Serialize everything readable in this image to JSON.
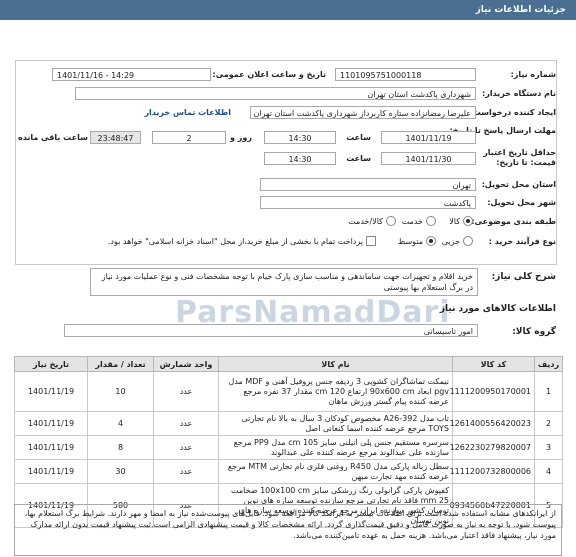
{
  "header": {
    "title": "جزئیات اطلاعات نیاز"
  },
  "form": {
    "need_number_label": "شماره نیاز:",
    "need_number": "1101095751000118",
    "announce_label": "تاریخ و ساعت اعلان عمومی:",
    "announce_value": "1401/11/16 - 14:29",
    "buyer_label": "نام دستگاه خریدار:",
    "buyer_value": "شهرداری پاکدشت استان تهران",
    "creator_label": "ایجاد کننده درخواست:",
    "creator_value": "علیرضا رمضانزاده ستاره کاربرداز شهرداری پاکدشت استان تهران",
    "contact_link": "اطلاعات تماس خریدار",
    "deadline_label": "مهلت ارسال پاسخ تا تاریخ:",
    "deadline_date": "1401/11/19",
    "time_label": "ساعت",
    "deadline_time": "14:30",
    "day_value": "2",
    "day_label": "روز و",
    "countdown": "23:48:47",
    "remaining_label": "ساعت باقی مانده",
    "validity_label": "حداقل تاریخ اعتبار",
    "validity_label2": "قیمت: تا تاریخ:",
    "validity_date": "1401/11/30",
    "validity_time": "14:30",
    "province_label": "استان محل تحویل:",
    "province_value": "تهران",
    "city_label": "شهر محل تحویل:",
    "city_value": "پاکدشت",
    "category_label": "طبقه بندی موضوعی:",
    "category_options": [
      "کالا",
      "خدمت",
      "کالا/خدمت"
    ],
    "purchase_type_label": "نوع فرآیند خرید :",
    "purchase_options": [
      "جزیی",
      "متوسط"
    ],
    "payment_note": "پرداخت تمام یا بخشی از مبلغ خرید،از محل \"اسناد خزانه اسلامی\" خواهد بود."
  },
  "need": {
    "summary_label": "شرح کلی نیاز:",
    "summary": "خرید اقلام و تجهیزات جهت ساماندهی و مناسب سازی پارک خیام با توجه مشخصات فنی و نوع عملیات مورد نیاز در برگ استعلام بها پیوستی",
    "goods_title": "اطلاعات کالاهای مورد نیاز",
    "group_label": "گروه کالا:",
    "group_value": "امور تاسیساتی"
  },
  "table": {
    "headers": [
      "ردیف",
      "کد کالا",
      "نام کالا",
      "واحد شمارش",
      "تعداد / مقدار",
      "تاریخ نیاز"
    ],
    "rows": [
      {
        "row": "1",
        "code": "1111200950170001",
        "name": "نیمکت تماشاگران کشویی 3 ردیفه جنس پروفیل آهنی و MDF مدل pgv ابعاد 90x600 cm ارتفاع 120 cm مقدار 37 نفره مرجع عرضه کننده پیام گستر ورزش ماهان",
        "unit": "عدد",
        "qty": "10",
        "date": "1401/11/19"
      },
      {
        "row": "2",
        "code": "1261400556420023",
        "name": "تاب مدل A26-392 مخصوص کودکان 3 سال به بالا نام تجارتی TOYS مرجع عرضه کننده اسما کنعانی اصل",
        "unit": "عدد",
        "qty": "4",
        "date": "1401/11/19"
      },
      {
        "row": "3",
        "code": "1262230279820007",
        "name": "سرسره مستقیم جنس پلی اتیلنی سایز 105 cm مدل PP9 مرجع سازنده علی عبدالوند مرجع عرضه کننده علی عبدالوند",
        "unit": "عدد",
        "qty": "8",
        "date": "1401/11/19"
      },
      {
        "row": "4",
        "code": "1111200732800006",
        "name": "سطل زباله پارکی مدل R450 روغنی فلزی نام تجارتی MTM مرجع عرضه کننده مهد تجارت میهن",
        "unit": "عدد",
        "qty": "30",
        "date": "1401/11/19"
      },
      {
        "row": "5",
        "code": "0934560b47220001",
        "name": "کفپوش پارکی گرانولی رنگ زرشکی سایز 100x100 cm ضخامت 25 mm فاقد نام تجارتی مرجع سازنده توسعه سازه های نوین توسان کشور سازنده ایران مرجع عرضه کننده توسعه سازه های نوین توسان",
        "unit": "عدد",
        "qty": "580",
        "date": "1401/11/19"
      }
    ]
  },
  "notes": {
    "text": "از ایرانکدهای مشابه استفاده شده است.برای اطلاعات بیشتر به ایرانکد کالا مراجعه شود. فایل‌های پیوست‌شده نیاز به امضا و مهر دارند. شرایط برگ استعلام بها، پیوست شود. با توجه به نیاز به صورت کامل و دقیق قیمت‌گذاری گردد. ارائه مشخصات کالا و قیمت پیشنهادی الزامی است.ثبت پیشنهاد قیمت بدون ارائه مدارک مورد نیاز، پیشنهاد فاقد اعتبار می‌باشد. هزینه حمل به عهده تامین‌کننده می‌باشد."
  },
  "watermark": {
    "text": "ParsNamadDari"
  }
}
